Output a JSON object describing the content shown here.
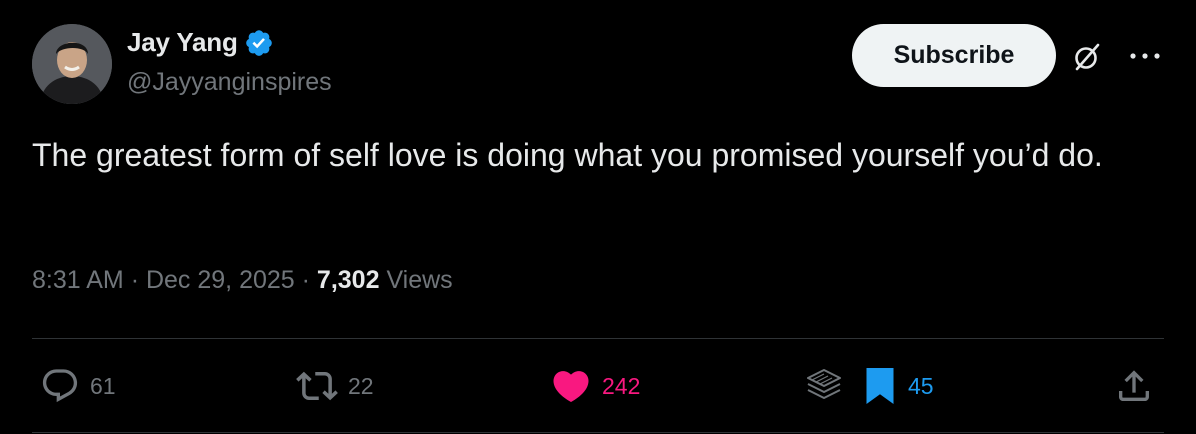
{
  "author": {
    "display_name": "Jay Yang",
    "handle": "@Jayyanginspires",
    "verified": true,
    "verified_color": "#1d9bf0"
  },
  "header_actions": {
    "subscribe_label": "Subscribe",
    "grok_icon": "slashed-circle-icon",
    "more_icon": "more-horizontal-icon"
  },
  "tweet": {
    "text": "The greatest form of self love is doing what you promised yourself you’d do."
  },
  "meta": {
    "time": "8:31 AM",
    "separator": "·",
    "date": "Dec 29, 2025",
    "views_count": "7,302",
    "views_label": "Views"
  },
  "actions": {
    "replies": "61",
    "reposts": "22",
    "likes": "242",
    "bookmarks": "45",
    "like_color": "#f91880",
    "bookmark_color": "#1d9bf0",
    "icons": [
      "reply-icon",
      "repost-icon",
      "heart-icon",
      "layers-icon",
      "bookmark-icon",
      "share-icon"
    ]
  }
}
